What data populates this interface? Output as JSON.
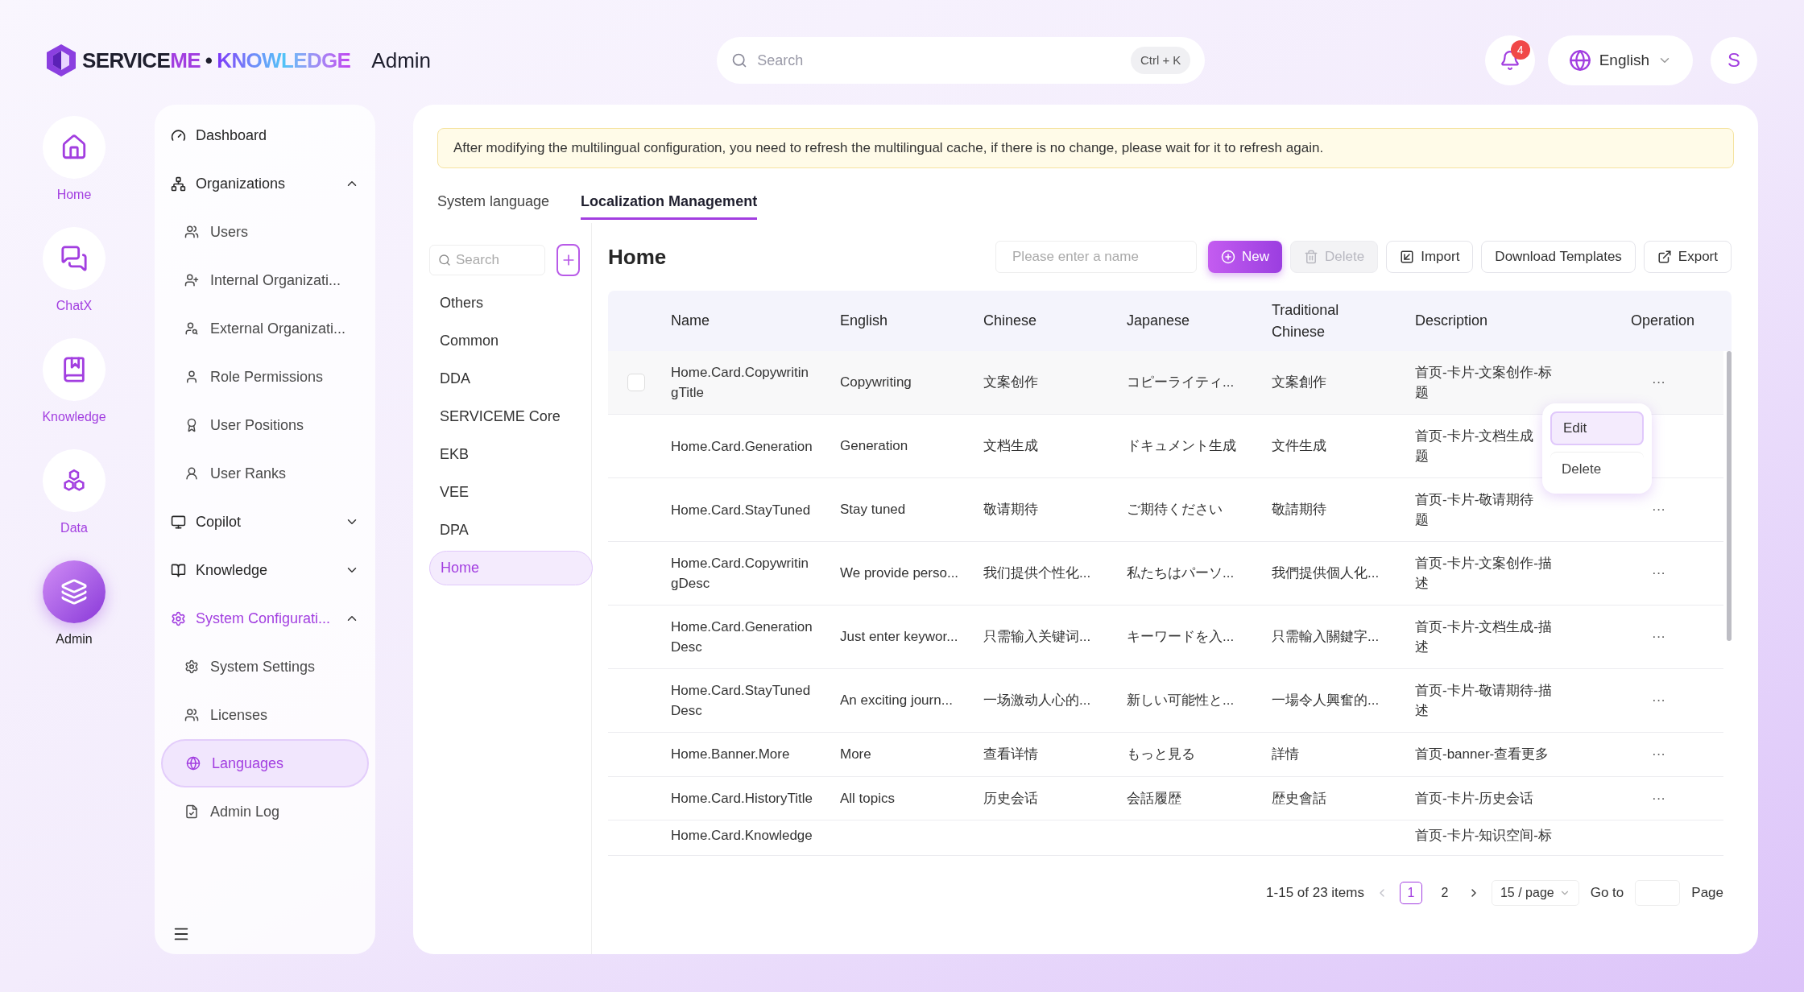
{
  "header": {
    "brand_parts": [
      "SERVICE",
      "ME",
      "•",
      "KNOWLEDGE"
    ],
    "app_title": "Admin",
    "search": {
      "placeholder": "Search",
      "shortcut": "Ctrl + K"
    },
    "notifications": "4",
    "language": "English",
    "avatar": "S"
  },
  "rail": [
    {
      "label": "Home",
      "kind": "home",
      "selected": false
    },
    {
      "label": "ChatX",
      "kind": "chat",
      "selected": false
    },
    {
      "label": "Knowledge",
      "kind": "book",
      "selected": false
    },
    {
      "label": "Data",
      "kind": "hexagons",
      "selected": false
    },
    {
      "label": "Admin",
      "kind": "layers",
      "selected": true
    }
  ],
  "sidebar": {
    "items": [
      {
        "label": "Dashboard",
        "kind": "gauge",
        "highlighted": false
      },
      {
        "label": "Organizations",
        "kind": "org",
        "highlighted": false,
        "expanded": true,
        "children": [
          {
            "label": "Users",
            "kind": "users",
            "selected": false
          },
          {
            "label": "Internal Organizati...",
            "kind": "user-plus",
            "selected": false
          },
          {
            "label": "External Organizati...",
            "kind": "user-search",
            "selected": false
          },
          {
            "label": "Role Permissions",
            "kind": "user",
            "selected": false
          },
          {
            "label": "User Positions",
            "kind": "tie",
            "selected": false
          },
          {
            "label": "User Ranks",
            "kind": "user-round",
            "selected": false
          }
        ]
      },
      {
        "label": "Copilot",
        "kind": "monitor",
        "highlighted": false,
        "expanded": false
      },
      {
        "label": "Knowledge",
        "kind": "book-open",
        "highlighted": false,
        "expanded": false
      },
      {
        "label": "System Configurati...",
        "kind": "settings",
        "highlighted": true,
        "expanded": true,
        "children": [
          {
            "label": "System Settings",
            "kind": "settings",
            "selected": false
          },
          {
            "label": "Licenses",
            "kind": "users",
            "selected": false
          },
          {
            "label": "Languages",
            "kind": "globe",
            "selected": true
          },
          {
            "label": "Admin Log",
            "kind": "file",
            "selected": false
          }
        ]
      }
    ]
  },
  "notice": "After modifying the multilingual configuration, you need to refresh the multilingual cache, if there is no change, please wait for it to refresh again.",
  "tabs": [
    {
      "label": "System language",
      "selected": false
    },
    {
      "label": "Localization Management",
      "selected": true
    }
  ],
  "categories": {
    "search": {
      "placeholder": "Search"
    },
    "items": [
      {
        "label": "Others",
        "selected": false
      },
      {
        "label": "Common",
        "selected": false
      },
      {
        "label": "DDA",
        "selected": false
      },
      {
        "label": "SERVICEME Core",
        "selected": false
      },
      {
        "label": "EKB",
        "selected": false
      },
      {
        "label": "VEE",
        "selected": false
      },
      {
        "label": "DPA",
        "selected": false
      },
      {
        "label": "Home",
        "selected": true
      }
    ]
  },
  "panel": {
    "title": "Home",
    "name_search": {
      "placeholder": "Please enter a name"
    },
    "toolbar": [
      {
        "label": "New",
        "kind": "primary",
        "disabled": false
      },
      {
        "label": "Delete",
        "kind": "delete",
        "disabled": true
      },
      {
        "label": "Import",
        "kind": "import",
        "disabled": false
      },
      {
        "label": "Download Templates",
        "kind": "plain",
        "disabled": false
      },
      {
        "label": "Export",
        "kind": "export",
        "disabled": false
      }
    ]
  },
  "table": {
    "columns": [
      "Name",
      "English",
      "Chinese",
      "Japanese",
      "Traditional Chinese",
      "Description",
      "Operation"
    ],
    "rows": [
      {
        "hovered": true,
        "name": "Home.Card.CopywritingTitle",
        "english": "Copywriting",
        "chinese": "文案创作",
        "japanese": "コピーライティ...",
        "traditional_chinese": "文案創作",
        "description": "首页-卡片-文案创作-标题",
        "operation": "···"
      },
      {
        "hovered": false,
        "name": "Home.Card.Generation",
        "english": "Generation",
        "chinese": "文档生成",
        "japanese": "ドキュメント生成",
        "traditional_chinese": "文件生成",
        "description": "首页-卡片-文档生成",
        "description_2": "题"
      },
      {
        "hovered": false,
        "name": "Home.Card.StayTuned",
        "english": "Stay tuned",
        "chinese": "敬请期待",
        "japanese": "ご期待ください",
        "traditional_chinese": "敬請期待",
        "description": "首页-卡片-敬请期待",
        "description_2": "题",
        "operation": "···"
      },
      {
        "hovered": false,
        "name": "Home.Card.CopywritingDesc",
        "english": "We provide perso...",
        "chinese": "我们提供个性化...",
        "japanese": "私たちはパーソ...",
        "traditional_chinese": "我們提供個人化...",
        "description": "首页-卡片-文案创作-描述",
        "operation": "···"
      },
      {
        "hovered": false,
        "name": "Home.Card.GenerationDesc",
        "english": "Just enter keywor...",
        "chinese": "只需输入关键词...",
        "japanese": "キーワードを入...",
        "traditional_chinese": "只需輸入關鍵字...",
        "description": "首页-卡片-文档生成-描述",
        "operation": "···"
      },
      {
        "hovered": false,
        "name": "Home.Card.StayTunedDesc",
        "english": "An exciting journ...",
        "chinese": "一场激动人心的...",
        "japanese": "新しい可能性と...",
        "traditional_chinese": "一場令人興奮的...",
        "description": "首页-卡片-敬请期待-描述",
        "operation": "···"
      },
      {
        "hovered": false,
        "name": "Home.Banner.More",
        "english": "More",
        "chinese": "查看详情",
        "japanese": "もっと見る",
        "traditional_chinese": "詳情",
        "description": "首页-banner-查看更多",
        "operation": "···"
      },
      {
        "hovered": false,
        "name": "Home.Card.HistoryTitle",
        "english": "All topics",
        "chinese": "历史会话",
        "japanese": "会話履歴",
        "traditional_chinese": "歴史會話",
        "description": "首页-卡片-历史会话",
        "operation": "···"
      },
      {
        "hovered": false,
        "cut": true,
        "name": "Home.Card.Knowledge",
        "description": "首页-卡片-知识空间-标"
      }
    ]
  },
  "row_menu": [
    {
      "label": "Edit",
      "selected": true
    },
    {
      "label": "Delete",
      "selected": false
    }
  ],
  "pagination": {
    "summary": "1-15 of 23 items",
    "pages": [
      {
        "label": "1",
        "selected": true
      },
      {
        "label": "2",
        "selected": false
      }
    ],
    "page_size": "15 / page",
    "goto": "Go to",
    "page_label": "Page"
  }
}
